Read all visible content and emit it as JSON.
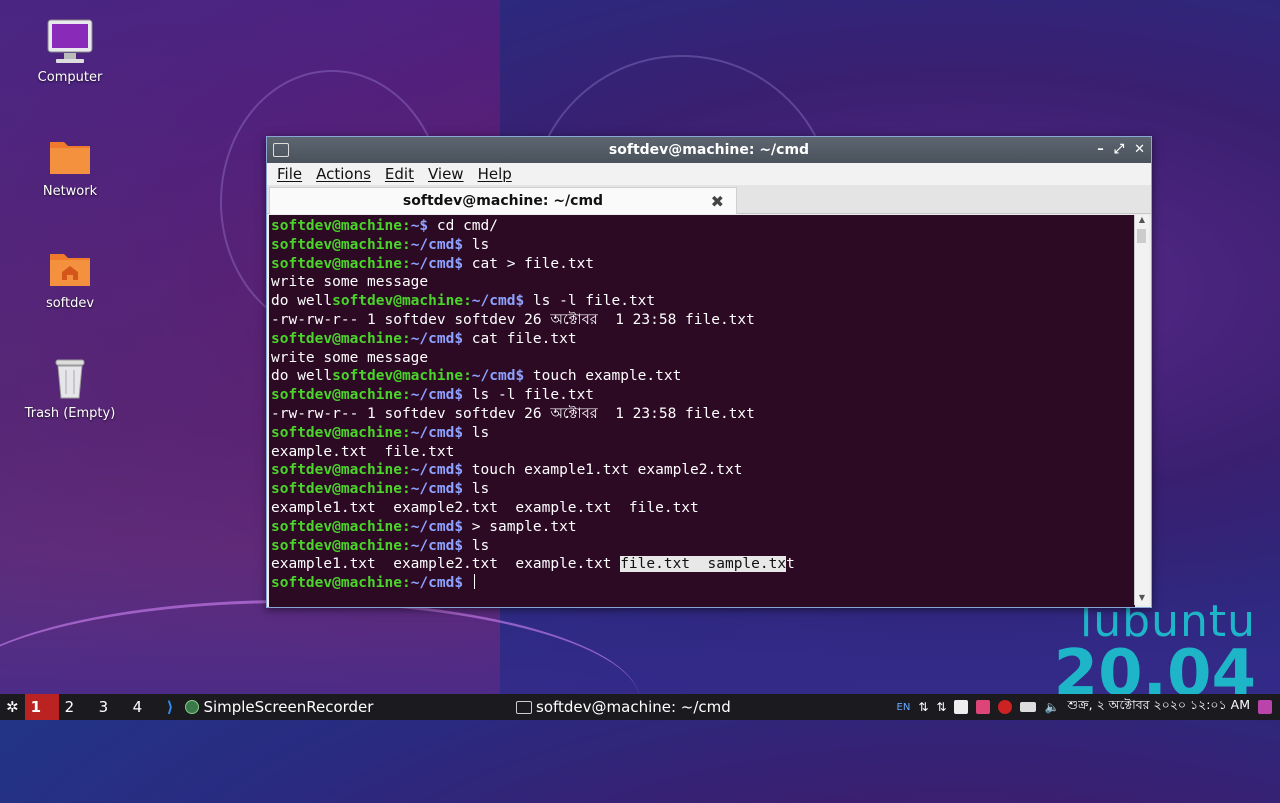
{
  "desktop": {
    "icons": [
      {
        "label": "Computer",
        "icon": "computer-icon"
      },
      {
        "label": "Network",
        "icon": "folder-icon"
      },
      {
        "label": "softdev",
        "icon": "home-folder-icon"
      },
      {
        "label": "Trash (Empty)",
        "icon": "trash-icon"
      }
    ],
    "brand": {
      "name": "lubuntu",
      "version": "20.04",
      "color": "#1fb5c9"
    }
  },
  "window": {
    "title": "softdev@machine: ~/cmd",
    "controls": {
      "minimize": "–",
      "restore": "⤢",
      "close": "✕"
    },
    "menu": [
      "File",
      "Actions",
      "Edit",
      "View",
      "Help"
    ],
    "tab": {
      "label": "softdev@machine: ~/cmd",
      "close": "✖"
    }
  },
  "terminal": {
    "colors": {
      "user": "#4bd42a",
      "path": "#8fa2ff",
      "bg": "#2c0a24"
    },
    "lines": [
      {
        "pre": "",
        "user": "softdev@machine",
        "path": "~",
        "cmd": " cd cmd/"
      },
      {
        "pre": "",
        "user": "softdev@machine",
        "path": "~/cmd",
        "cmd": " ls"
      },
      {
        "pre": "",
        "user": "softdev@machine",
        "path": "~/cmd",
        "cmd": " cat > file.txt"
      },
      {
        "out": "write some message"
      },
      {
        "pre": "do well",
        "user": "softdev@machine",
        "path": "~/cmd",
        "cmd": " ls -l file.txt"
      },
      {
        "out": "-rw-rw-r-- 1 softdev softdev 26 অক্টোবর  1 23:58 file.txt"
      },
      {
        "pre": "",
        "user": "softdev@machine",
        "path": "~/cmd",
        "cmd": " cat file.txt"
      },
      {
        "out": "write some message"
      },
      {
        "pre": "do well",
        "user": "softdev@machine",
        "path": "~/cmd",
        "cmd": " touch example.txt"
      },
      {
        "pre": "",
        "user": "softdev@machine",
        "path": "~/cmd",
        "cmd": " ls -l file.txt"
      },
      {
        "out": "-rw-rw-r-- 1 softdev softdev 26 অক্টোবর  1 23:58 file.txt"
      },
      {
        "pre": "",
        "user": "softdev@machine",
        "path": "~/cmd",
        "cmd": " ls"
      },
      {
        "out": "example.txt  file.txt"
      },
      {
        "pre": "",
        "user": "softdev@machine",
        "path": "~/cmd",
        "cmd": " touch example1.txt example2.txt"
      },
      {
        "pre": "",
        "user": "softdev@machine",
        "path": "~/cmd",
        "cmd": " ls"
      },
      {
        "out": "example1.txt  example2.txt  example.txt  file.txt"
      },
      {
        "pre": "",
        "user": "softdev@machine",
        "path": "~/cmd",
        "cmd": " > sample.txt"
      },
      {
        "pre": "",
        "user": "softdev@machine",
        "path": "~/cmd",
        "cmd": " ls"
      },
      {
        "out": "example1.txt  example2.txt  example.txt ",
        "sel": "file.txt  sample.tx",
        "after": "t"
      },
      {
        "pre": "",
        "user": "softdev@machine",
        "path": "~/cmd",
        "cmd": " ",
        "cursor": true
      }
    ]
  },
  "taskbar": {
    "workspaces": [
      "1",
      "2",
      "3",
      "4"
    ],
    "active_workspace": "1",
    "apps": [
      {
        "label": "SimpleScreenRecorder",
        "icon": "recorder-icon"
      },
      {
        "label": "softdev@machine: ~/cmd",
        "icon": "terminal-icon"
      }
    ],
    "tray": {
      "lang": "EN",
      "clock": "শুক্র, ২ অক্টোবর ২০২০ ১২:০১ AM"
    }
  }
}
